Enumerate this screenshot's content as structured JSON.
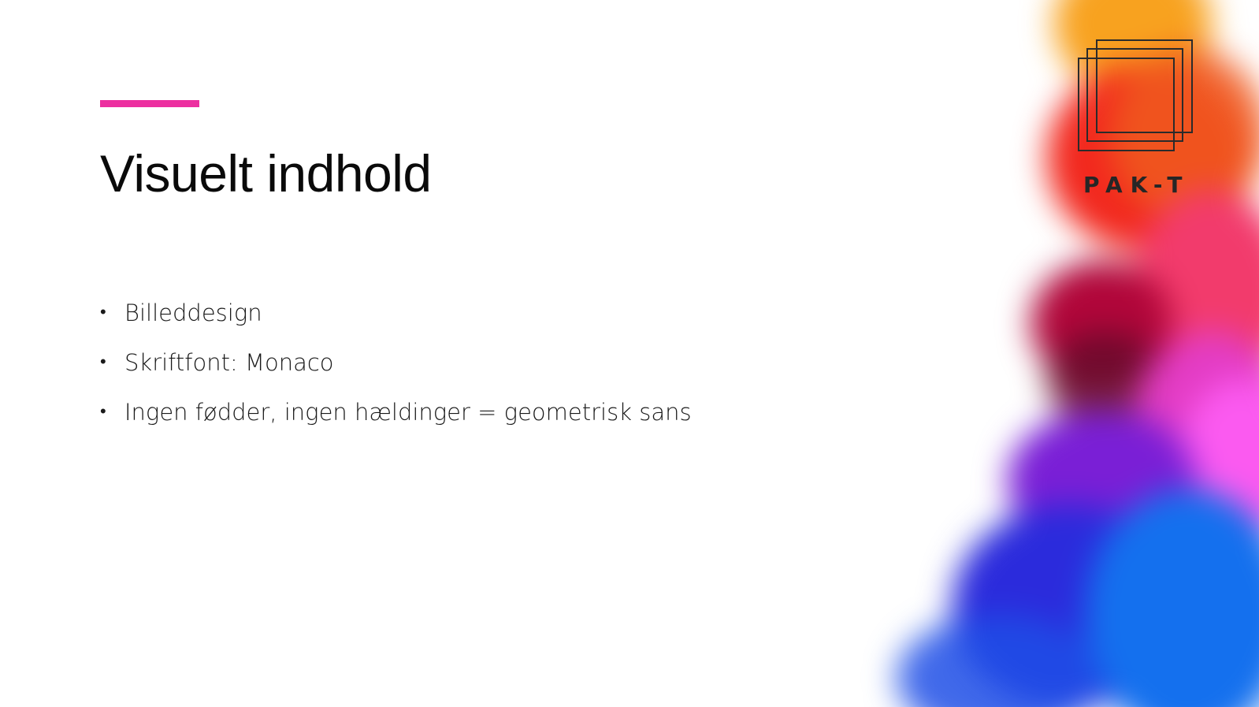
{
  "slide": {
    "title": "Visuelt indhold",
    "accent_color": "#ec2fa0",
    "bullets": [
      {
        "marker": "•",
        "text": "Billeddesign"
      },
      {
        "marker": "•",
        "text": "Skriftfont: Monaco"
      },
      {
        "marker": "•",
        "text": "Ingen fødder, ingen hældinger = geometrisk sans"
      }
    ]
  },
  "logo": {
    "text": "PAK-T",
    "icon": "overlapping-squares-icon"
  },
  "decoration": {
    "type": "colorful-ink-smoke",
    "colors": [
      "#f8a21f",
      "#f2281e",
      "#e8156b",
      "#b1063a",
      "#6b0a2c",
      "#e33cc4",
      "#fb5af0",
      "#7a1fd6",
      "#2b2bdc",
      "#1470ee"
    ]
  }
}
